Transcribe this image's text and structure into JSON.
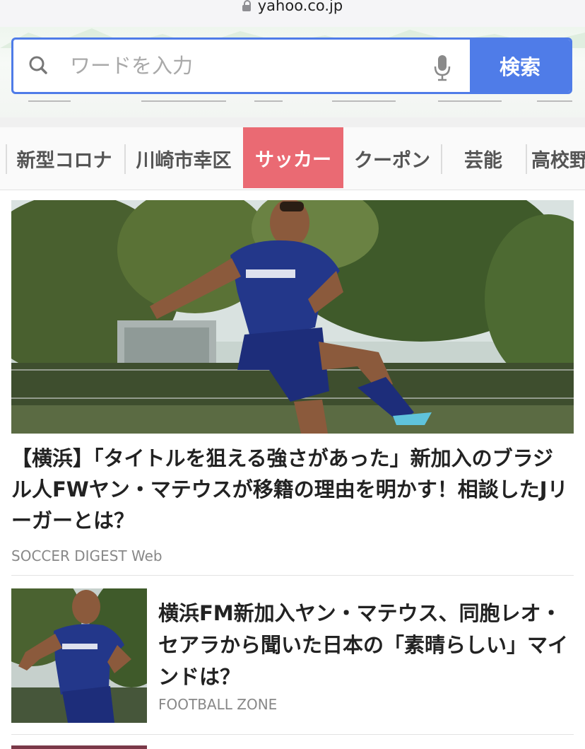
{
  "browser": {
    "url": "yahoo.co.jp"
  },
  "search": {
    "placeholder": "ワードを入力",
    "button_label": "検索"
  },
  "tabs": [
    {
      "label": "新型コロナ",
      "active": false
    },
    {
      "label": "川崎市幸区",
      "active": false
    },
    {
      "label": "サッカー",
      "active": true
    },
    {
      "label": "クーポン",
      "active": false
    },
    {
      "label": "芸能",
      "active": false
    },
    {
      "label": "高校野",
      "active": false
    }
  ],
  "articles": [
    {
      "title": "【横浜】「タイトルを狙える強さがあった」新加入のブラジル人FWヤン・マテウスが移籍の理由を明かす！相談したJリーガーとは？",
      "source": "SOCCER DIGEST Web"
    },
    {
      "title": "横浜FM新加入ヤン・マテウス、同胞レオ・セアラから聞いた日本の「素晴らしい」マインドは？",
      "source": "FOOTBALL ZONE"
    }
  ],
  "colors": {
    "accent": "#4f7ce8",
    "active_tab": "#ea6a73"
  },
  "icons": {
    "lock": "lock-icon",
    "search": "search-icon",
    "mic": "mic-icon"
  }
}
